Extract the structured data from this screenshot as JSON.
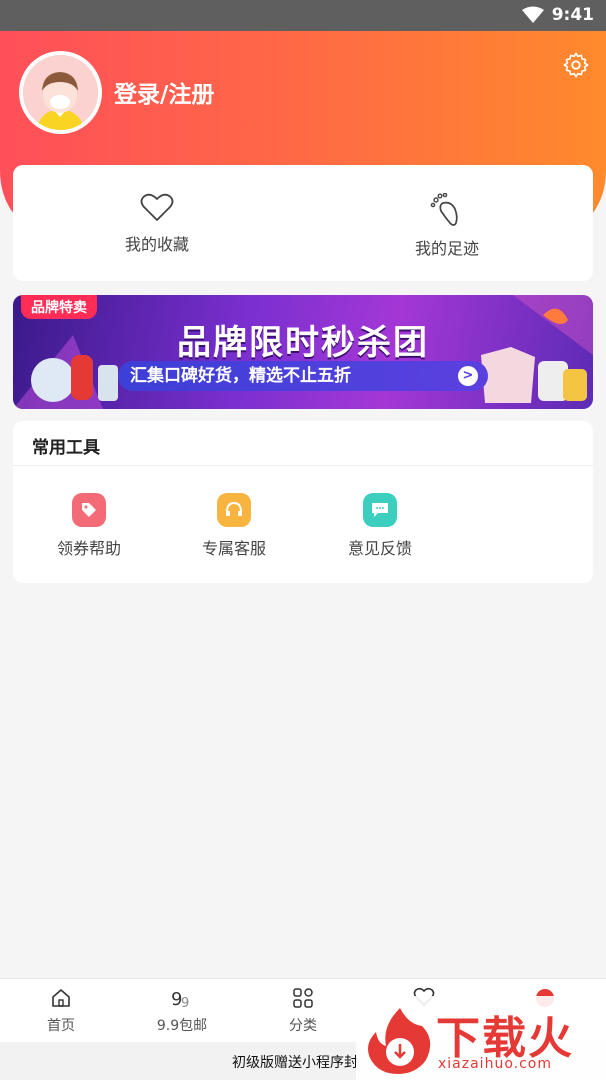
{
  "status_bar": {
    "time": "9:41"
  },
  "profile": {
    "login_label": "登录/注册"
  },
  "quick_links": [
    {
      "label": "我的收藏",
      "icon": "heart-icon"
    },
    {
      "label": "我的足迹",
      "icon": "footprint-icon"
    }
  ],
  "banner": {
    "tag": "品牌特卖",
    "title": "品牌限时秒杀团",
    "subtitle": "汇集口碑好货，精选不止五折",
    "arrow": ">"
  },
  "tools": {
    "title": "常用工具",
    "items": [
      {
        "label": "领券帮助",
        "icon": "tag-icon",
        "color": "#f46b78"
      },
      {
        "label": "专属客服",
        "icon": "headset-icon",
        "color": "#f7b43f"
      },
      {
        "label": "意见反馈",
        "icon": "chat-icon",
        "color": "#3ccfc0"
      }
    ]
  },
  "tab_bar": {
    "items": [
      {
        "label": "首页",
        "icon": "home-icon"
      },
      {
        "label": "9.9包邮",
        "icon": "nine-nine-icon"
      },
      {
        "label": "分类",
        "icon": "grid-icon"
      },
      {
        "label": "",
        "icon": "heart-icon"
      },
      {
        "label": "",
        "icon": "profile-icon"
      }
    ]
  },
  "footer_text": "初级版赠送小程序封",
  "watermark": {
    "brand": "下载火",
    "domain": "xiazaihuo.com"
  }
}
